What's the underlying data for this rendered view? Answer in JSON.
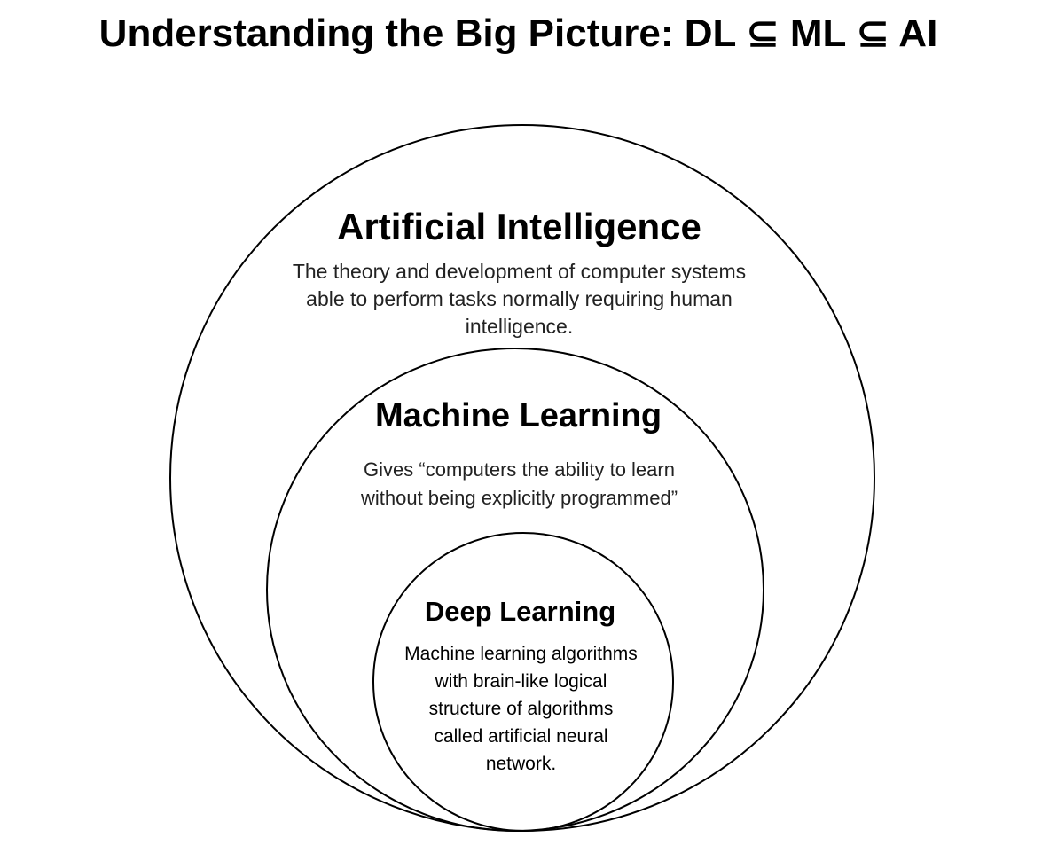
{
  "title": "Understanding the Big Picture: DL ⊆ ML ⊆ AI",
  "ai": {
    "heading": "Artificial Intelligence",
    "lines": [
      "The theory and development of computer systems",
      "able to perform tasks normally requiring human",
      "intelligence."
    ]
  },
  "ml": {
    "heading": "Machine Learning",
    "lines": [
      "Gives “computers the ability to learn",
      "without being explicitly programmed”"
    ]
  },
  "dl": {
    "heading": "Deep Learning",
    "lines": [
      "Machine learning algorithms",
      "with brain-like logical",
      "structure of algorithms",
      "called artificial neural",
      "network."
    ]
  }
}
